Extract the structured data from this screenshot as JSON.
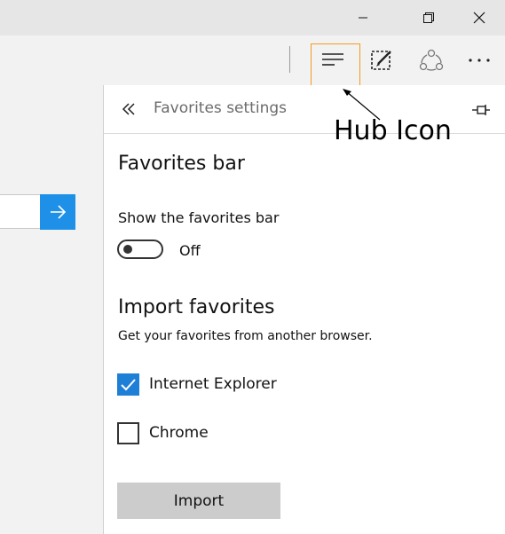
{
  "window": {
    "controls": [
      "minimize-icon",
      "restore-icon",
      "close-icon"
    ]
  },
  "toolbar": {
    "icons": [
      "hub-icon",
      "web-note-icon",
      "share-icon",
      "more-icon"
    ]
  },
  "address": {
    "go_icon": "arrow-right-icon"
  },
  "panel": {
    "title": "Favorites settings",
    "favorites_bar": {
      "heading": "Favorites bar",
      "toggle_label": "Show the favorites bar",
      "toggle_state": "Off"
    },
    "import": {
      "heading": "Import favorites",
      "subtitle": "Get your favorites from another browser.",
      "browsers": [
        {
          "label": "Internet Explorer",
          "checked": true
        },
        {
          "label": "Chrome",
          "checked": false
        }
      ],
      "button_label": "Import"
    }
  },
  "annotation": {
    "text": "Hub Icon"
  },
  "colors": {
    "accent": "#1e7fd6",
    "highlight_box": "#f39b1c",
    "go_button": "#1e90e8"
  }
}
